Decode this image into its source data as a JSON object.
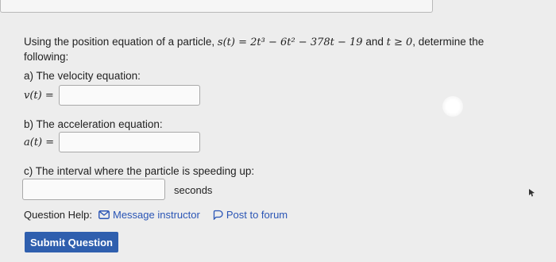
{
  "problem": {
    "prefix": "Using the position equation of a particle, ",
    "equation": "s(t) = 2t³ − 6t² − 378t − 19",
    "condition_prefix": " and ",
    "condition": "t ≥ 0",
    "suffix": ", determine the following:"
  },
  "velocity": {
    "label": "a) The velocity equation:",
    "symbol": "v(t) =",
    "value": ""
  },
  "acceleration": {
    "label": "b) The acceleration equation:",
    "symbol": "a(t) =",
    "value": ""
  },
  "speeding": {
    "label": "c) The interval where the particle is speeding up:",
    "value": "",
    "unit": "seconds"
  },
  "help": {
    "label": "Question Help:",
    "message_link": "Message instructor",
    "forum_link": "Post to forum"
  },
  "submit_label": "Submit Question",
  "colors": {
    "link": "#2a55b5",
    "button": "#2f5fae",
    "background": "#ededed"
  },
  "icons": {
    "message": "envelope-icon",
    "forum": "speech-bubble-icon",
    "cursor": "mouse-pointer-icon"
  }
}
